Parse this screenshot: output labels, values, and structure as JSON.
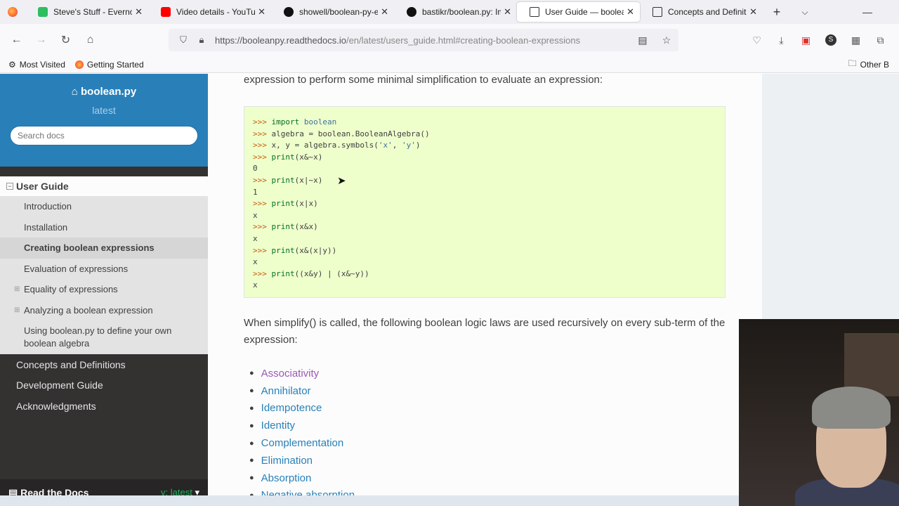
{
  "tabs": [
    {
      "label": "Steve's Stuff - Evernote",
      "icon": "evernote-icon"
    },
    {
      "label": "Video details - YouTube",
      "icon": "youtube-icon"
    },
    {
      "label": "showell/boolean-py-e",
      "icon": "github-icon"
    },
    {
      "label": "bastikr/boolean.py: Im",
      "icon": "github-icon"
    },
    {
      "label": "User Guide — boolean.",
      "icon": "doc-icon",
      "active": true
    },
    {
      "label": "Concepts and Definitio",
      "icon": "doc-icon"
    }
  ],
  "navbar": {
    "url_host": "https://booleanpy.readthedocs.io",
    "url_path": "/en/latest/users_guide.html#creating-boolean-expressions"
  },
  "bookmarks": {
    "most_visited": "Most Visited",
    "getting_started": "Getting Started",
    "other": "Other B"
  },
  "sidebar": {
    "project": "boolean.py",
    "version": "latest",
    "search_placeholder": "Search docs",
    "current_section": "User Guide",
    "subitems": [
      "Introduction",
      "Installation",
      "Creating boolean expressions",
      "Evaluation of expressions",
      "Equality of expressions",
      "Analyzing a boolean expression",
      "Using boolean.py to define your own boolean algebra"
    ],
    "top_items": [
      "Concepts and Definitions",
      "Development Guide",
      "Acknowledgments"
    ],
    "rtd_label": "Read the Docs",
    "rtd_version": "v: latest"
  },
  "content": {
    "intro_text": "expression to perform some minimal simplification to evaluate an expression:",
    "code": [
      ">>> import boolean",
      ">>> algebra = boolean.BooleanAlgebra()",
      ">>> x, y = algebra.symbols('x', 'y')",
      ">>> print(x&~x)",
      "0",
      ">>> print(x|~x)",
      "1",
      ">>> print(x|x)",
      "x",
      ">>> print(x&x)",
      "x",
      ">>> print(x&(x|y))",
      "x",
      ">>> print((x&y) | (x&~y))",
      "x"
    ],
    "simplify_text": "When simplify() is called, the following boolean logic laws are used recursively on every sub-term of the expression:",
    "laws": [
      "Associativity",
      "Annihilator",
      "Idempotence",
      "Identity",
      "Complementation",
      "Elimination",
      "Absorption",
      "Negative absorption"
    ]
  }
}
